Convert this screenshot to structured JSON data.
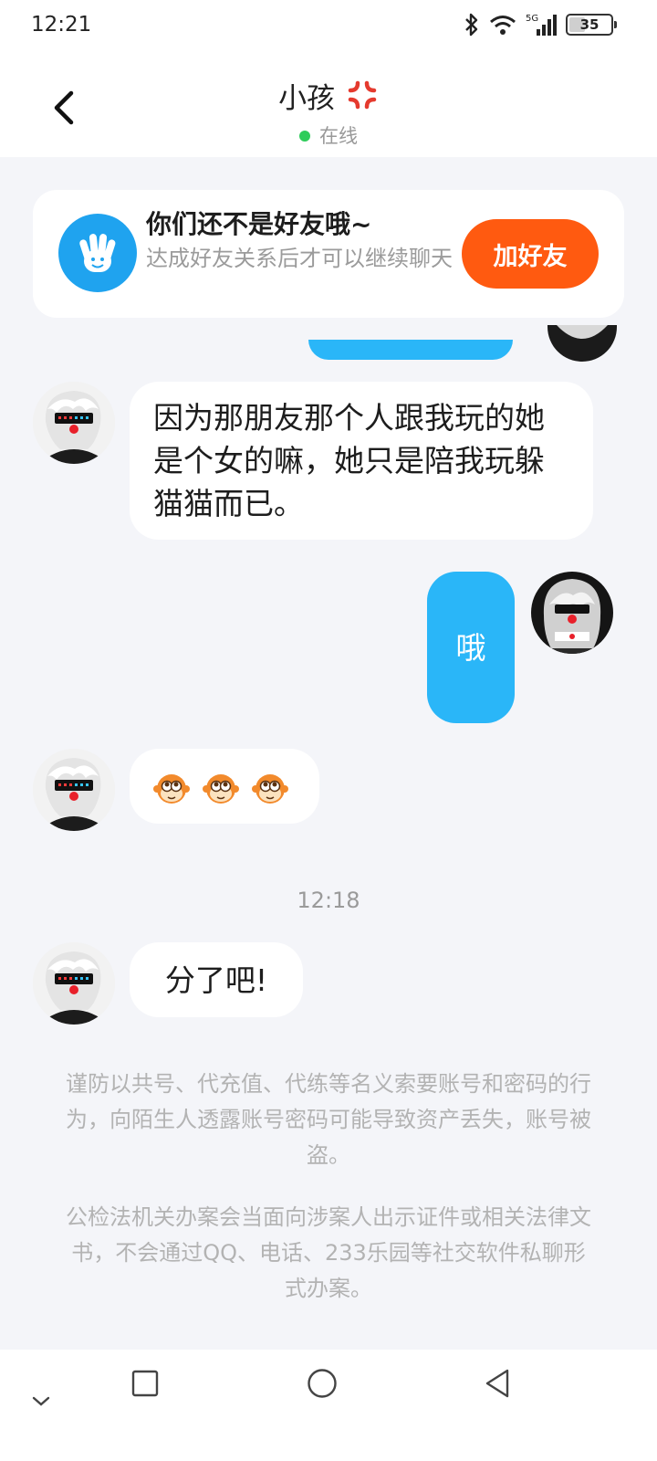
{
  "status_bar": {
    "time": "12:21",
    "network": "5G",
    "battery": "35"
  },
  "header": {
    "title": "小孩",
    "status": "在线"
  },
  "friend_banner": {
    "title": "你们还不是好友哦~",
    "description": "达成好友关系后才可以继续聊天",
    "button": "加好友"
  },
  "messages": [
    {
      "side": "left",
      "text": "因为那朋友那个人跟我玩的她是个女的嘛，她只是陪我玩躲猫猫而已。"
    },
    {
      "side": "right",
      "text": "哦"
    },
    {
      "side": "left",
      "text": "emoji-monkey-face ×3"
    },
    {
      "side": "left",
      "text": "分了吧!"
    }
  ],
  "time_divider": "12:18",
  "notices": [
    "谨防以共号、代充值、代练等名义索要账号和密码的行为，向陌生人透露账号密码可能导致资产丢失，账号被盗。",
    "公检法机关办案会当面向涉案人出示证件或相关法律文书，不会通过QQ、电话、233乐园等社交软件私聊形式办案。"
  ],
  "colors": {
    "accent_blue": "#2ab6f8",
    "add_button": "#ff5a10",
    "online": "#2ecc5a",
    "background": "#f4f5f9"
  }
}
